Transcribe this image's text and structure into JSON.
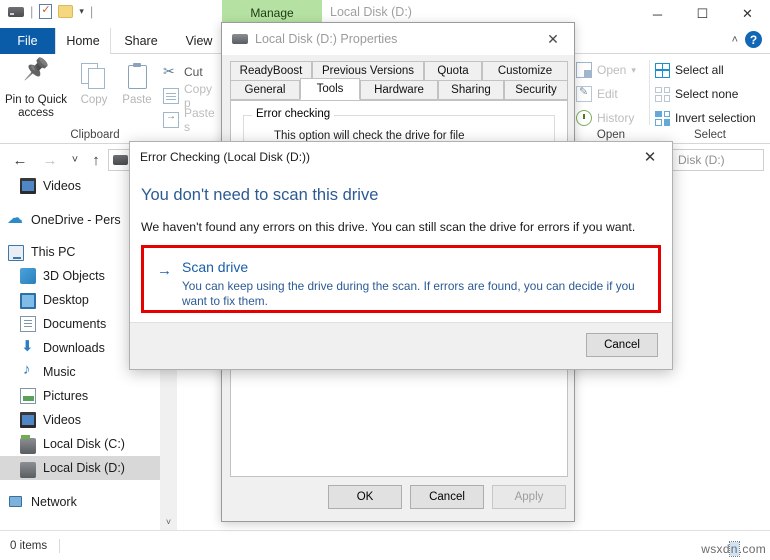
{
  "window": {
    "title": "Local Disk (D:)",
    "contextual_tab": "Manage",
    "minimize": "─",
    "maximize": "☐",
    "close": "✕",
    "quick_access": [
      "drive-icon",
      "properties-icon",
      "new-folder-icon",
      "customize-caret"
    ]
  },
  "ribbon": {
    "tabs": [
      {
        "label": "File",
        "id": "file"
      },
      {
        "label": "Home",
        "id": "home"
      },
      {
        "label": "Share",
        "id": "share"
      },
      {
        "label": "View",
        "id": "view"
      }
    ],
    "help": "?",
    "collapse": "˄",
    "clipboard": {
      "label": "Clipboard",
      "pin": "Pin to Quick\naccess",
      "pin_line1": "Pin to Quick",
      "pin_line2": "access",
      "copy": "Copy",
      "paste": "Paste",
      "cut": "Cut",
      "copy_path": "Copy p",
      "paste_shortcut": "Paste s"
    },
    "open_group": {
      "label": "Open",
      "open": "Open",
      "open_caret": "▾",
      "edit": "Edit",
      "history": "History"
    },
    "select_group": {
      "label": "Select",
      "select_all": "Select all",
      "select_none": "Select none",
      "invert_selection": "Invert selection"
    }
  },
  "address": {
    "back": "←",
    "forward": "→",
    "recent": "˅",
    "up": "↑",
    "path": "",
    "search_value": "Disk (D:)"
  },
  "sidebar": {
    "items": [
      {
        "label": "Videos",
        "icon": "videos-icon",
        "indent": 20,
        "selected": false
      },
      {
        "label": "OneDrive - Pers",
        "icon": "onedrive-icon",
        "indent": 8,
        "selected": false
      },
      {
        "label": "This PC",
        "icon": "this-pc-icon",
        "indent": 8,
        "selected": false
      },
      {
        "label": "3D Objects",
        "icon": "3d-objects-icon",
        "indent": 20,
        "selected": false
      },
      {
        "label": "Desktop",
        "icon": "desktop-icon",
        "indent": 20,
        "selected": false
      },
      {
        "label": "Documents",
        "icon": "documents-icon",
        "indent": 20,
        "selected": false
      },
      {
        "label": "Downloads",
        "icon": "downloads-icon",
        "indent": 20,
        "selected": false
      },
      {
        "label": "Music",
        "icon": "music-icon",
        "indent": 20,
        "selected": false
      },
      {
        "label": "Pictures",
        "icon": "pictures-icon",
        "indent": 20,
        "selected": false
      },
      {
        "label": "Videos",
        "icon": "videos-icon",
        "indent": 20,
        "selected": false
      },
      {
        "label": "Local Disk (C:)",
        "icon": "local-disk-c-icon",
        "indent": 20,
        "selected": false
      },
      {
        "label": "Local Disk (D:)",
        "icon": "local-disk-d-icon",
        "indent": 20,
        "selected": true
      },
      {
        "label": "Network",
        "icon": "network-icon",
        "indent": 8,
        "selected": false
      }
    ],
    "scroll_arrow": "˅"
  },
  "status": {
    "items_count": "0 items"
  },
  "properties_dialog": {
    "title": "Local Disk (D:) Properties",
    "close": "✕",
    "tabs_top": [
      "ReadyBoost",
      "Previous Versions",
      "Quota",
      "Customize"
    ],
    "tabs_bottom": [
      "General",
      "Tools",
      "Hardware",
      "Sharing",
      "Security"
    ],
    "active_tab": "Tools",
    "group_legend": "Error checking",
    "group_text": "This option will check the drive for file",
    "buttons": {
      "ok": "OK",
      "cancel": "Cancel",
      "apply": "Apply"
    }
  },
  "error_checking_dialog": {
    "title": "Error Checking (Local Disk (D:))",
    "close": "✕",
    "heading": "You don't need to scan this drive",
    "subtext": "We haven't found any errors on this drive. You can still scan the drive for errors if you want.",
    "action": {
      "arrow": "→",
      "title": "Scan drive",
      "description": "You can keep using the drive during the scan. If errors are found, you can decide if you want to fix them."
    },
    "cancel": "Cancel",
    "highlight_color": "#e60000",
    "link_color": "#1a5fa8",
    "heading_color": "#2c5a94"
  },
  "watermark": {
    "prefix": "wsxd",
    "selected": "n",
    "suffix": ".com"
  }
}
